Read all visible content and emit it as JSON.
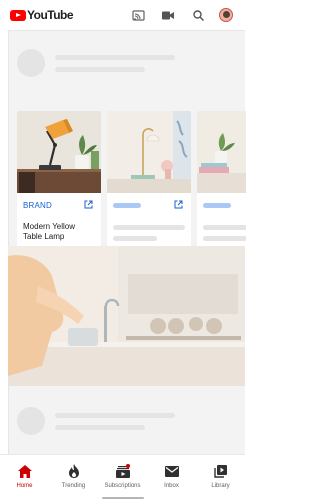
{
  "app": {
    "logo_text": "YouTube"
  },
  "topbar": {
    "icons": [
      "cast-icon",
      "camera-icon",
      "search-icon",
      "account-avatar"
    ]
  },
  "products": [
    {
      "brand": "BRAND",
      "title": "Modern Yellow Table Lamp",
      "loaded": true
    },
    {
      "brand": "",
      "title": "",
      "loaded": false
    },
    {
      "brand": "",
      "title": "",
      "loaded": false
    }
  ],
  "bottom_nav": [
    {
      "label": "Home",
      "icon": "home-icon",
      "active": true
    },
    {
      "label": "Trending",
      "icon": "flame-icon",
      "active": false
    },
    {
      "label": "Subscriptions",
      "icon": "subscriptions-icon",
      "active": false,
      "badge": true
    },
    {
      "label": "Inbox",
      "icon": "mail-icon",
      "active": false
    },
    {
      "label": "Library",
      "icon": "library-icon",
      "active": false
    }
  ],
  "colors": {
    "brand_red": "#ff0000",
    "active_nav": "#cc0000",
    "link_blue": "#1a5fd6",
    "placeholder_gray": "#e4e4e4",
    "surface": "#f3f3f3"
  }
}
